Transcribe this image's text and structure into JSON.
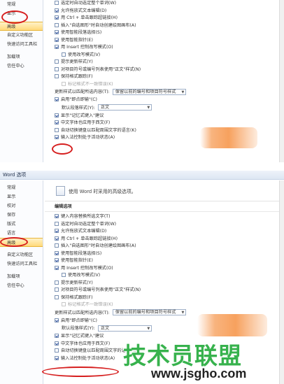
{
  "colors": {
    "annotation_red": "#d61f1f",
    "watermark_green": "#37b24d",
    "active_gold": "#ffd97a",
    "blob_orange": "#f7a15e"
  },
  "top_panel": {
    "sidebar": [
      "常规",
      "显示",
      "高级",
      "自定义功能区",
      "快速访问工具栏",
      "加载项",
      "信任中心"
    ],
    "rows": [
      {
        "label": "选定时自动选定整个单词(W)",
        "checked": false
      },
      {
        "label": "允许拖放式文本编辑(D)",
        "checked": true
      },
      {
        "label": "用 Ctrl + 单击跟踪超链接(H)",
        "checked": true
      },
      {
        "label": "插入\"自选图形\"时自动创建绘图画布(A)",
        "checked": false
      },
      {
        "label": "使用智能段落选择(S)",
        "checked": true
      },
      {
        "label": "使用智能指针(E)",
        "checked": true
      },
      {
        "label": "用 Insert 控制改写模式(O)",
        "checked": true
      },
      {
        "label": "使用改写模式(V)",
        "checked": false,
        "sub": true
      },
      {
        "label": "提示更新样式(Y)",
        "checked": false
      },
      {
        "label": "对项目符号或编号列表使用\"正文\"样式(N)",
        "checked": false
      },
      {
        "label": "保持格式跟踪(F)",
        "checked": false
      },
      {
        "label": "标记格式不一致错误(K)",
        "checked": false,
        "sub": true,
        "disabled": true
      }
    ],
    "combo1_label": "更新样式以匹配所选内容(T):",
    "combo1_value": "保留以前的编号和项目符号样式",
    "rows2": [
      {
        "label": "启用\"即点即输\"(C)",
        "checked": true
      }
    ],
    "combo2_label": "默认段落样式(Y):",
    "combo2_value": "正文",
    "rows3": [
      {
        "label": "显示\"记忆式键入\"建议",
        "checked": true
      },
      {
        "label": "中文字体也应用于西文(F)",
        "checked": true
      },
      {
        "label": "自动切换键盘以匹配周围文字的语言(K)",
        "checked": false
      },
      {
        "label": "输入法控制处于活动状态(A)",
        "checked": true
      }
    ]
  },
  "bottom_panel": {
    "title": "Word 选项",
    "sidebar_upper": [
      "常规",
      "显示",
      "校对",
      "保存",
      "版式",
      "语言",
      "高级"
    ],
    "sidebar_lower": [
      "自定义功能区",
      "快速访问工具栏"
    ],
    "sidebar_after": [
      "加载项",
      "信任中心"
    ],
    "header": "使用 Word 时采用的高级选项。",
    "section": "编辑选项",
    "rows": [
      {
        "label": "键入内容替换所选文字(T)",
        "checked": true
      },
      {
        "label": "选定时自动选定整个单词(W)",
        "checked": false
      },
      {
        "label": "允许拖放式文本编辑(D)",
        "checked": true
      },
      {
        "label": "用 Ctrl + 单击跟踪超链接(H)",
        "checked": true
      },
      {
        "label": "插入\"自选图形\"时自动创建绘图画布(A)",
        "checked": false
      },
      {
        "label": "使用智能段落选择(S)",
        "checked": true
      },
      {
        "label": "使用智能指针(E)",
        "checked": true
      },
      {
        "label": "用 Insert 控制改写模式(O)",
        "checked": true
      },
      {
        "label": "使用改写模式(V)",
        "checked": false,
        "sub": true
      },
      {
        "label": "提示更新样式(Y)",
        "checked": false
      },
      {
        "label": "对项目符号或编号列表使用\"正文\"样式(N)",
        "checked": false
      },
      {
        "label": "保持格式跟踪(F)",
        "checked": false
      },
      {
        "label": "标记格式不一致错误(K)",
        "checked": false,
        "sub": true,
        "disabled": true
      }
    ],
    "combo1_label": "更新样式以匹配所选内容(T):",
    "combo1_value": "保留以前的编号和项目符号样式",
    "rows2": [
      {
        "label": "启用\"即点即输\"(C)",
        "checked": true
      }
    ],
    "combo2_label": "默认段落样式(Y):",
    "combo2_value": "正文",
    "rows3": [
      {
        "label": "显示\"记忆式键入\"建议",
        "checked": true
      },
      {
        "label": "中文字体也应用于西文(F)",
        "checked": true
      },
      {
        "label": "自动切换键盘以匹配周围文字的语言(K)",
        "checked": false
      },
      {
        "label": "输入法控制处于活动状态(A)",
        "checked": true
      }
    ]
  },
  "watermark": {
    "brand": "技术员联盟",
    "url": "www.jsgho.com"
  }
}
